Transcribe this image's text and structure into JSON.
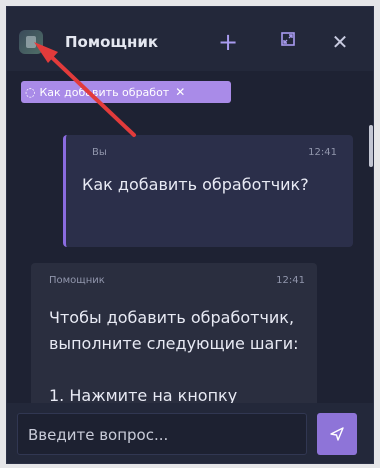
{
  "header": {
    "title": "Помощник",
    "actions": {
      "new_chat_icon": "plus-icon",
      "expand_icon": "expand-icon",
      "close_icon": "close-icon"
    }
  },
  "context_chip": {
    "label": "Как добавить обработ",
    "icon": "chat-icon",
    "remove_icon": "close-icon"
  },
  "messages": [
    {
      "author": "Вы",
      "time": "12:41",
      "text": "Как добавить обработчик?"
    },
    {
      "author": "Помощник",
      "time": "12:41",
      "text": "Чтобы добавить обработчик, выполните следующие шаги:\n\n1. Нажмите на кнопку"
    }
  ],
  "input": {
    "placeholder": "Введите вопрос..."
  },
  "colors": {
    "panel_bg": "#1e2233",
    "accent": "#8e74d8",
    "chip": "#a98be8",
    "annotation_arrow": "#e23b3b"
  }
}
